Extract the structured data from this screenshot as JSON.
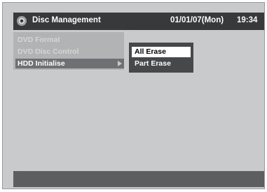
{
  "header": {
    "icon": "disc-icon",
    "title": "Disc Management",
    "date": "01/01/07(Mon)",
    "time": "19:34"
  },
  "menu": {
    "items": [
      {
        "label": "DVD Format",
        "state": "disabled"
      },
      {
        "label": "DVD Disc Control",
        "state": "disabled"
      },
      {
        "label": "HDD Initialise",
        "state": "selected"
      }
    ]
  },
  "submenu": {
    "items": [
      {
        "label": "All Erase",
        "state": "selected"
      },
      {
        "label": "Part Erase",
        "state": "normal"
      }
    ]
  },
  "colors": {
    "screen_bg": "#c9cacc",
    "header_bg": "#38393b",
    "menu_selected_bg": "#6f7073",
    "submenu_bg": "#47484a",
    "footer_bg": "#5d5e60"
  }
}
